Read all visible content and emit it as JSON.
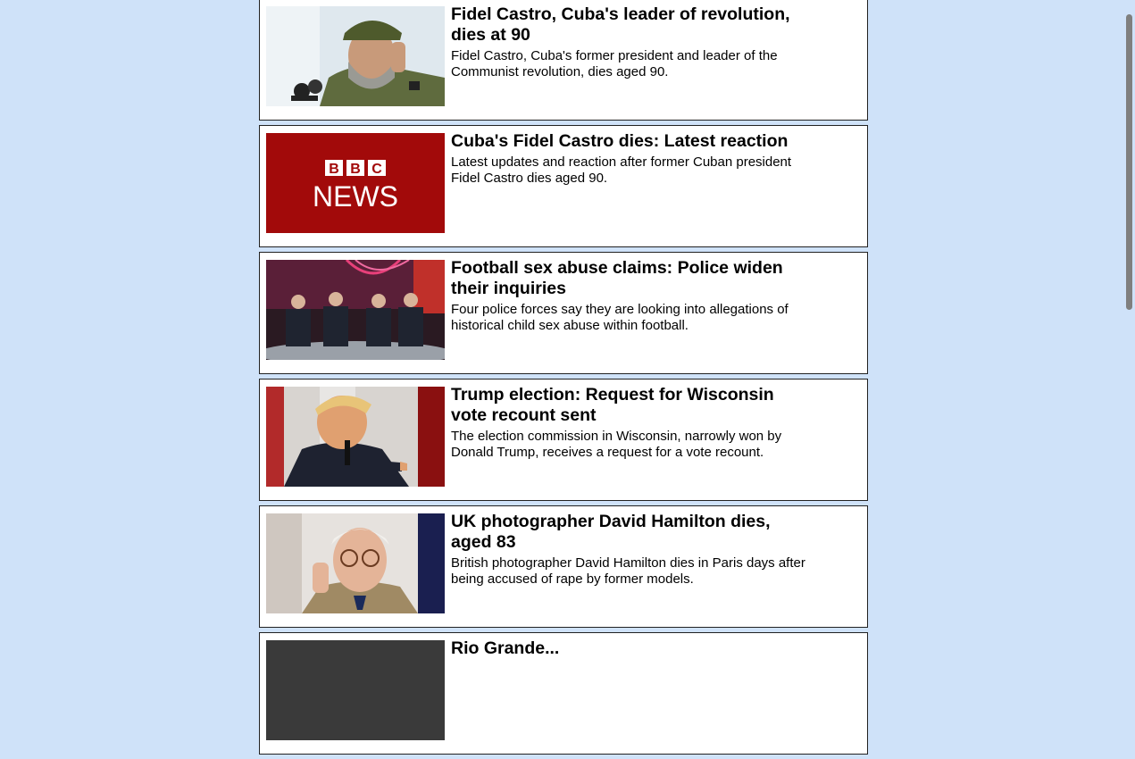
{
  "stories": [
    {
      "headline": "Fidel Castro, Cuba's leader of revolution, dies at 90",
      "summary": "Fidel Castro, Cuba's former president and leader of the Communist revolution, dies aged 90.",
      "image": "fidel-castro-photo"
    },
    {
      "headline": "Cuba's Fidel Castro dies: Latest reaction",
      "summary": "Latest updates and reaction after former Cuban president Fidel Castro dies aged 90.",
      "image": "bbc-news-logo",
      "logo": {
        "brand": "BBC",
        "product": "NEWS",
        "color": "#a20a0a"
      }
    },
    {
      "headline": "Football sex abuse claims: Police widen their inquiries",
      "summary": "Four police forces say they are looking into allegations of historical child sex abuse within football.",
      "image": "tv-studio-panel-photo"
    },
    {
      "headline": "Trump election: Request for Wisconsin vote recount sent",
      "summary": "The election commission in Wisconsin, narrowly won by Donald Trump, receives a request for a vote recount.",
      "image": "donald-trump-photo"
    },
    {
      "headline": "UK photographer David Hamilton dies, aged 83",
      "summary": "British photographer David Hamilton dies in Paris days after being accused of rape by former models.",
      "image": "david-hamilton-photo"
    },
    {
      "headline": "Rio Grande...",
      "summary": "",
      "image": "partial-photo"
    }
  ]
}
